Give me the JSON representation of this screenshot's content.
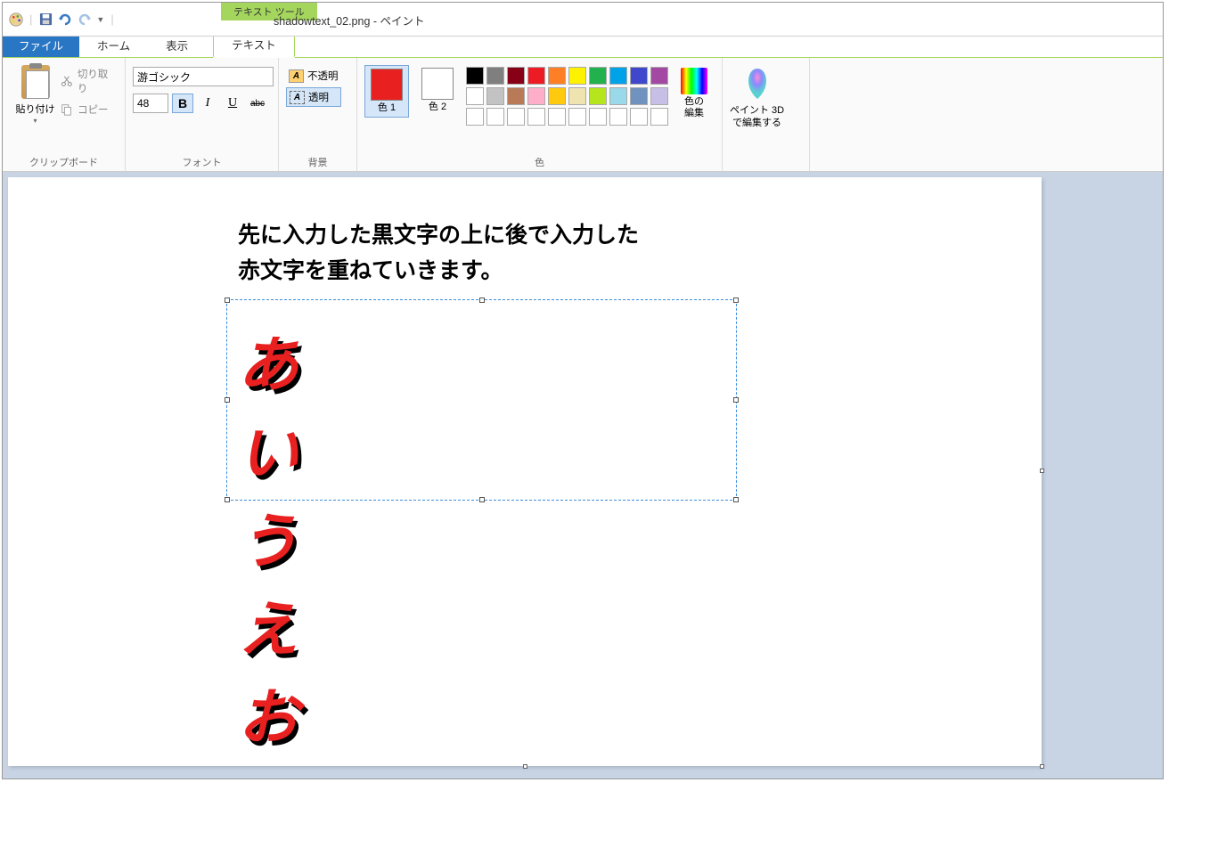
{
  "title_bar": {
    "window_title": "shadowtext_02.png - ペイント",
    "tool_tab": "テキスト ツール"
  },
  "tabs": {
    "file": "ファイル",
    "home": "ホーム",
    "view": "表示",
    "text": "テキスト"
  },
  "ribbon": {
    "clipboard": {
      "paste": "貼り付け",
      "cut": "切り取り",
      "copy": "コピー",
      "group_label": "クリップボード"
    },
    "font": {
      "font_name": "游ゴシック",
      "font_size": "48",
      "bold": "B",
      "italic": "I",
      "underline": "U",
      "strike": "abc",
      "group_label": "フォント"
    },
    "background": {
      "opaque": "不透明",
      "transparent": "透明",
      "group_label": "背景"
    },
    "color": {
      "color1_label": "色 1",
      "color2_label": "色 2",
      "color1_value": "#e82020",
      "color2_value": "#ffffff",
      "edit_label": "色の 編集",
      "palette_row1": [
        "#000000",
        "#7f7f7f",
        "#880015",
        "#ed1c24",
        "#ff7f27",
        "#fff200",
        "#22b14c",
        "#00a2e8",
        "#3f48cc",
        "#a349a4"
      ],
      "palette_row2": [
        "#ffffff",
        "#c3c3c3",
        "#b97a57",
        "#ffaec9",
        "#ffc90e",
        "#efe4b0",
        "#b5e61d",
        "#99d9ea",
        "#7092be",
        "#c8bfe7"
      ],
      "palette_row3": [
        "#ffffff",
        "#ffffff",
        "#ffffff",
        "#ffffff",
        "#ffffff",
        "#ffffff",
        "#ffffff",
        "#ffffff",
        "#ffffff",
        "#ffffff"
      ],
      "group_label": "色"
    },
    "paint3d": {
      "label": "ペイント 3D で編集する"
    }
  },
  "canvas": {
    "text_line1": "先に入力した黒文字の上に後で入力した",
    "text_line2": "赤文字を重ねていきます。",
    "red_text": "あいうえお"
  }
}
